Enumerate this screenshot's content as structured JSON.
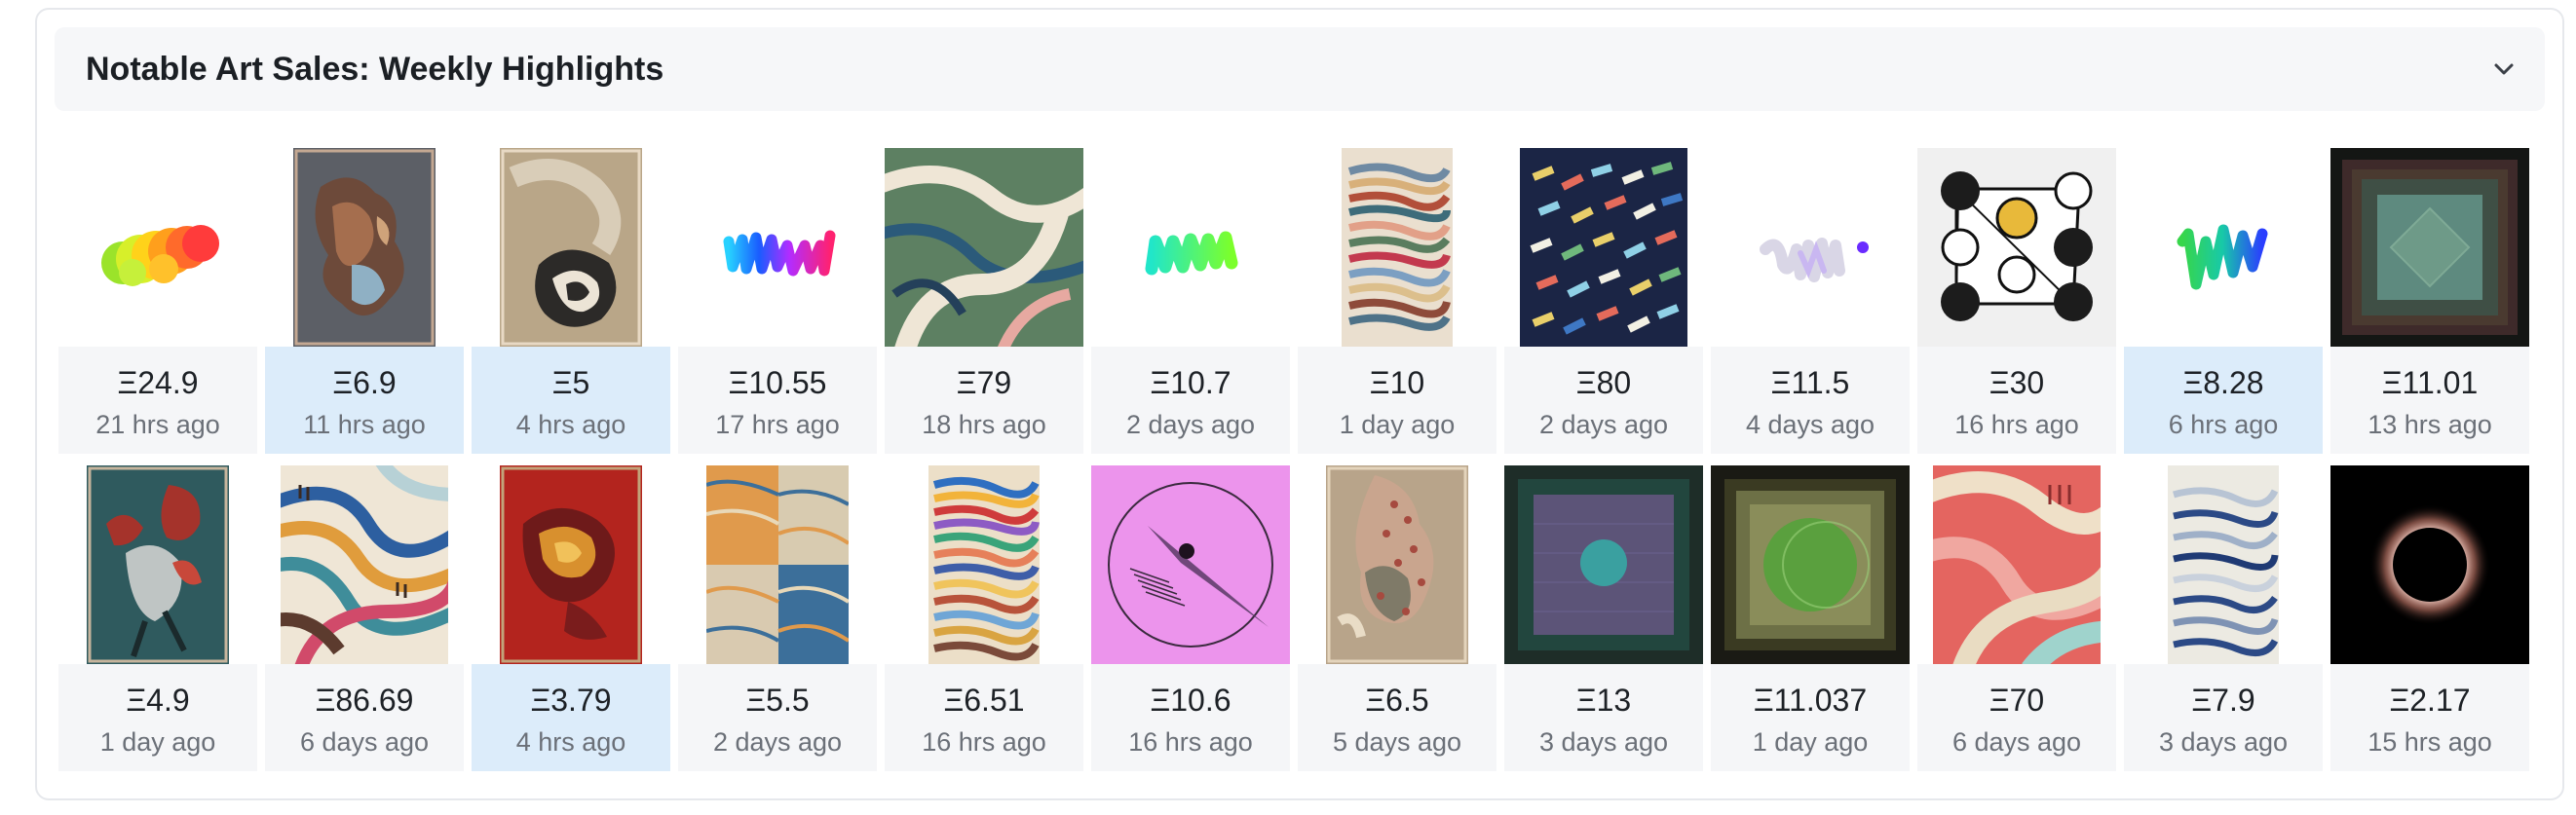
{
  "panel": {
    "title": "Notable Art Sales: Weekly Highlights",
    "toggle_icon": "chevron-down-icon"
  },
  "sales": [
    {
      "art": "rainbow-blob",
      "price": "Ξ24.9",
      "time": "21 hrs ago",
      "highlight": false
    },
    {
      "art": "gray-patchwork-figure",
      "price": "Ξ6.9",
      "time": "11 hrs ago",
      "highlight": true
    },
    {
      "art": "tan-ink-swirl",
      "price": "Ξ5",
      "time": "4 hrs ago",
      "highlight": true
    },
    {
      "art": "rainbow-scribble",
      "price": "Ξ10.55",
      "time": "17 hrs ago",
      "highlight": false
    },
    {
      "art": "green-flowing-stripes",
      "price": "Ξ79",
      "time": "18 hrs ago",
      "highlight": false
    },
    {
      "art": "green-cyan-scribble",
      "price": "Ξ10.7",
      "time": "2 days ago",
      "highlight": false
    },
    {
      "art": "layered-strata",
      "price": "Ξ10",
      "time": "1 day ago",
      "highlight": false
    },
    {
      "art": "navy-confetti-dashes",
      "price": "Ξ80",
      "time": "2 days ago",
      "highlight": false
    },
    {
      "art": "pale-lavender-scribble",
      "price": "Ξ11.5",
      "time": "4 days ago",
      "highlight": false
    },
    {
      "art": "circles-triangle",
      "price": "Ξ30",
      "time": "16 hrs ago",
      "highlight": false
    },
    {
      "art": "green-blue-scribble",
      "price": "Ξ8.28",
      "time": "6 hrs ago",
      "highlight": true
    },
    {
      "art": "nested-dark-squares",
      "price": "Ξ11.01",
      "time": "13 hrs ago",
      "highlight": false
    },
    {
      "art": "teal-red-figure",
      "price": "Ξ4.9",
      "time": "1 day ago",
      "highlight": false
    },
    {
      "art": "colorful-curvy-bands",
      "price": "Ξ86.69",
      "time": "6 days ago",
      "highlight": false
    },
    {
      "art": "red-gold-dragon",
      "price": "Ξ3.79",
      "time": "4 hrs ago",
      "highlight": true
    },
    {
      "art": "marbled-blocks",
      "price": "Ξ5.5",
      "time": "2 days ago",
      "highlight": false
    },
    {
      "art": "bright-strata",
      "price": "Ξ6.51",
      "time": "16 hrs ago",
      "highlight": false
    },
    {
      "art": "pink-circle-compass",
      "price": "Ξ10.6",
      "time": "16 hrs ago",
      "highlight": false
    },
    {
      "art": "beige-polka-figure",
      "price": "Ξ6.5",
      "time": "5 days ago",
      "highlight": false
    },
    {
      "art": "green-purple-square",
      "price": "Ξ13",
      "time": "3 days ago",
      "highlight": false
    },
    {
      "art": "olive-green-sphere",
      "price": "Ξ11.037",
      "time": "1 day ago",
      "highlight": false
    },
    {
      "art": "pink-wavy-bands",
      "price": "Ξ70",
      "time": "6 days ago",
      "highlight": false
    },
    {
      "art": "blue-wave-strata",
      "price": "Ξ7.9",
      "time": "3 days ago",
      "highlight": false
    },
    {
      "art": "black-eclipse",
      "price": "Ξ2.17",
      "time": "15 hrs ago",
      "highlight": false
    }
  ],
  "colors": {
    "highlight": "#dcecfa",
    "info_bg": "#f5f6f8",
    "header_bg": "#f6f7f9"
  }
}
